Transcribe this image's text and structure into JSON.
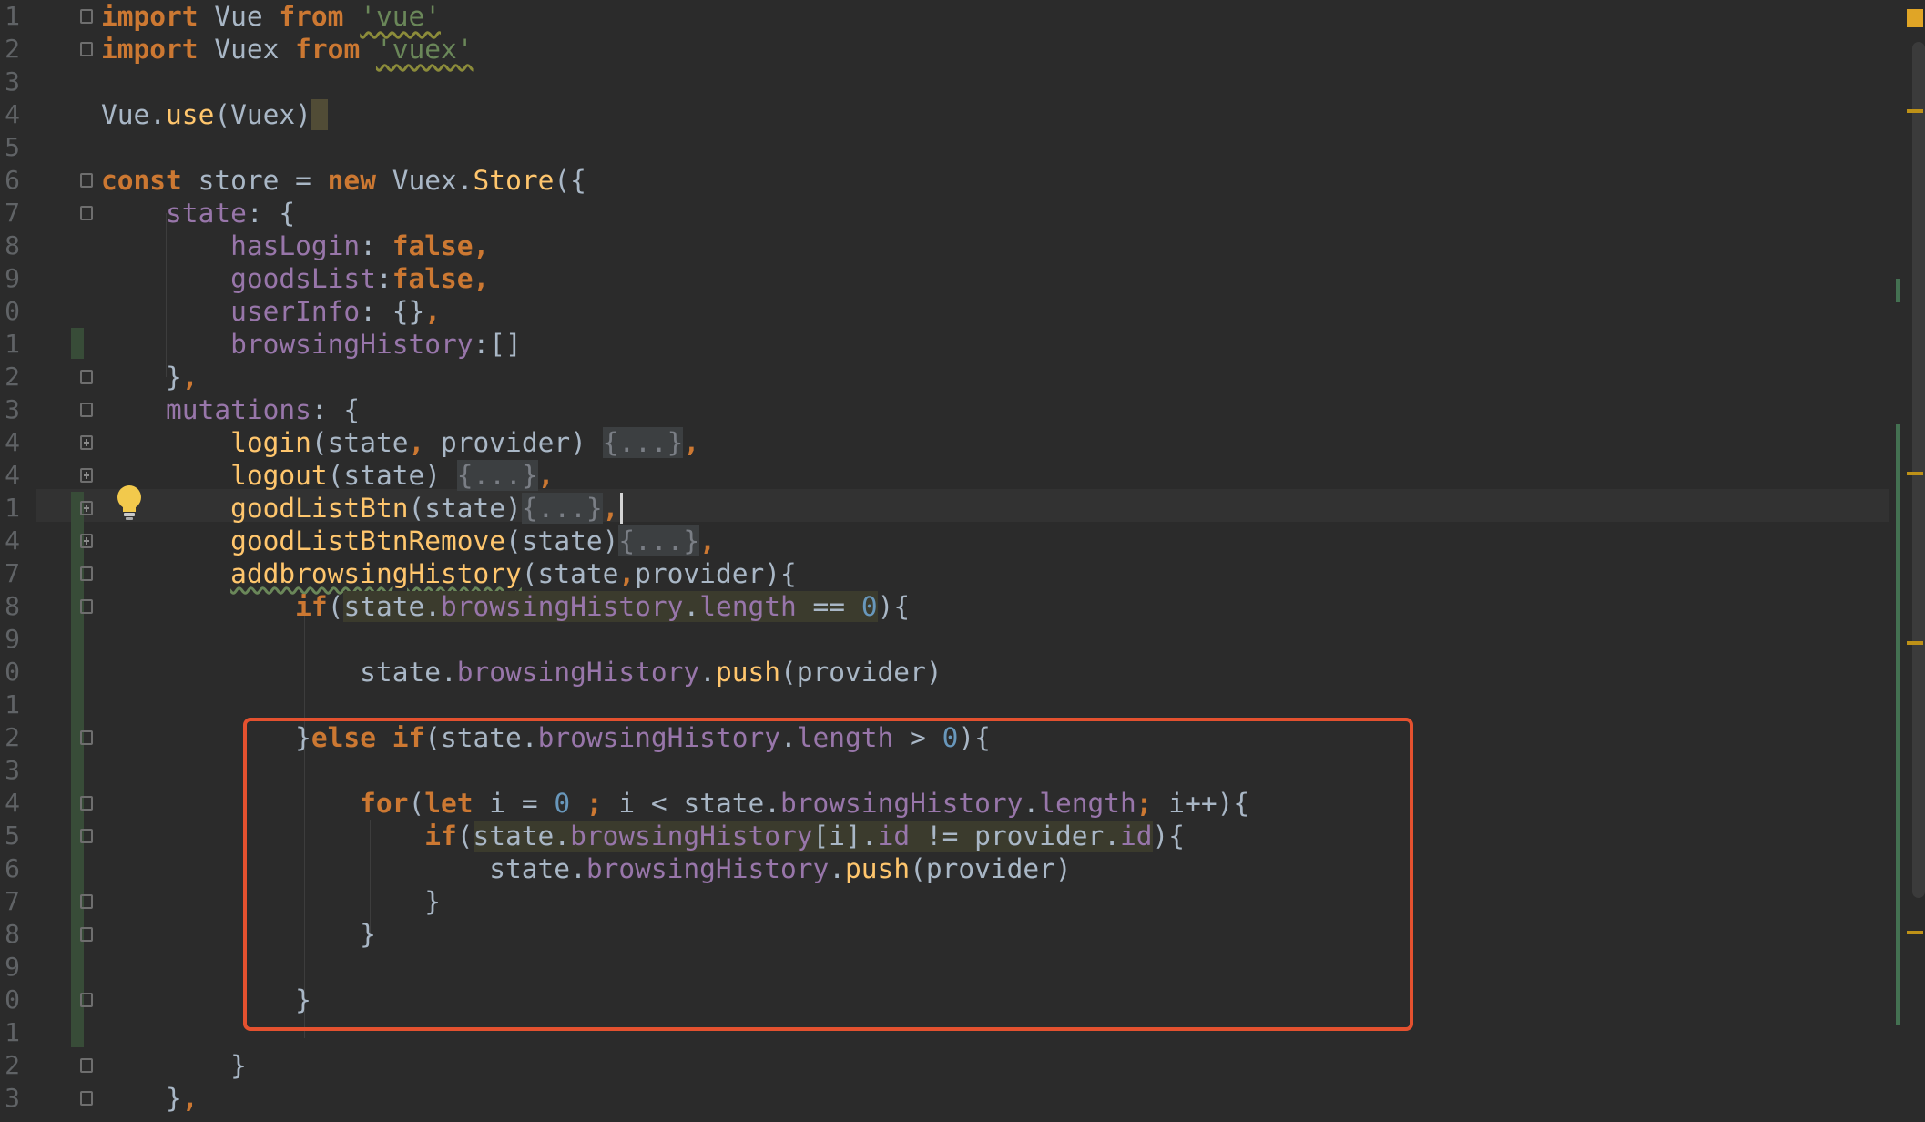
{
  "editor": {
    "line_numbers": [
      "1",
      "2",
      "3",
      "4",
      "5",
      "6",
      "7",
      "8",
      "9",
      "0",
      "1",
      "2",
      "3",
      "4",
      "4",
      "1",
      "4",
      "7",
      "8",
      "9",
      "0",
      "1",
      "2",
      "3",
      "4",
      "5",
      "6",
      "7",
      "8",
      "9",
      "0",
      "1",
      "2",
      "3"
    ],
    "folded_placeholder": "{...}",
    "code": {
      "l1": {
        "kw1": "import",
        "id": " Vue ",
        "kw2": "from",
        "str": "'vue'"
      },
      "l2": {
        "kw1": "import",
        "id": " Vuex ",
        "kw2": "from",
        "str": "'vuex'"
      },
      "l4": {
        "obj": "Vue.",
        "fn": "use",
        "args": "(Vuex)"
      },
      "l6": {
        "kw1": "const",
        "mid": " store = ",
        "kw2": "new",
        "obj": " Vuex.",
        "fn": "Store",
        "tail": "({"
      },
      "l7": {
        "prop": "state",
        "tail": ": {"
      },
      "l8": {
        "prop": "hasLogin",
        "colon": ": ",
        "val": "false",
        "comma": ","
      },
      "l9": {
        "prop": "goodsList",
        "colon": ":",
        "val": "false",
        "comma": ","
      },
      "l10": {
        "prop": "userInfo",
        "colon": ": {}",
        "comma": ","
      },
      "l11": {
        "prop": "browsingHistory",
        "tail": ":[]"
      },
      "l12": {
        "brace": "}",
        "comma": ","
      },
      "l13": {
        "prop": "mutations",
        "tail": ": {"
      },
      "l14": {
        "fn": "login",
        "args": "(state",
        "comma": ",",
        "args2": " provider) ",
        "comma2": ","
      },
      "l15": {
        "fn": "logout",
        "args": "(state) ",
        "comma": ","
      },
      "l16": {
        "fn": "goodListBtn",
        "args": "(state)",
        "comma": ","
      },
      "l17": {
        "fn": "goodListBtnRemove",
        "args": "(state)",
        "comma": ","
      },
      "l18": {
        "fn": "addbrowsingHistory",
        "args": "(state",
        "comma": ",",
        "args2": "provider){"
      },
      "l19": {
        "kw": "if",
        "open": "(",
        "obj": "state.",
        "prop": "browsingHistory",
        "dot": ".",
        "prop2": "length",
        "op": " == ",
        "num": "0",
        "tail": "){"
      },
      "l21": {
        "obj": "state.",
        "prop": "browsingHistory",
        "dot": ".",
        "fn": "push",
        "args": "(provider)"
      },
      "l23": {
        "brace": "}",
        "kw": "else if",
        "open": "(state.",
        "prop": "browsingHistory",
        "dot": ".",
        "prop2": "length",
        "op": " > ",
        "num": "0",
        "tail": "){"
      },
      "l25": {
        "kw1": "for",
        "open": "(",
        "kw2": "let",
        "var": " i = ",
        "num": "0",
        "semi1": " ;",
        "mid": " i < state.",
        "prop": "browsingHistory",
        "dot": ".",
        "prop2": "length",
        "semi2": ";",
        "tail": " i++){"
      },
      "l26": {
        "kw": "if",
        "open": "(",
        "obj": "state.",
        "prop": "browsingHistory",
        "idx": "[i].",
        "prop2": "id",
        "op": " != provider.",
        "prop3": "id",
        "tail": "){"
      },
      "l27": {
        "obj": "state.",
        "prop": "browsingHistory",
        "dot": ".",
        "fn": "push",
        "args": "(provider)"
      },
      "l28": {
        "brace": "}"
      },
      "l29": {
        "brace": "}"
      },
      "l31": {
        "brace": "}"
      },
      "l33": {
        "brace": "}"
      },
      "l34": {
        "brace": "}",
        "comma": ","
      }
    }
  },
  "colors": {
    "background": "#2b2b2b",
    "keyword": "#cc7832",
    "function": "#ffc66d",
    "property": "#9876aa",
    "number": "#6897bb",
    "string": "#6a8759",
    "highlight_box": "#e4512f"
  },
  "icons": {
    "gutter": "lightbulb-icon",
    "fold": "fold-marker-icon"
  }
}
